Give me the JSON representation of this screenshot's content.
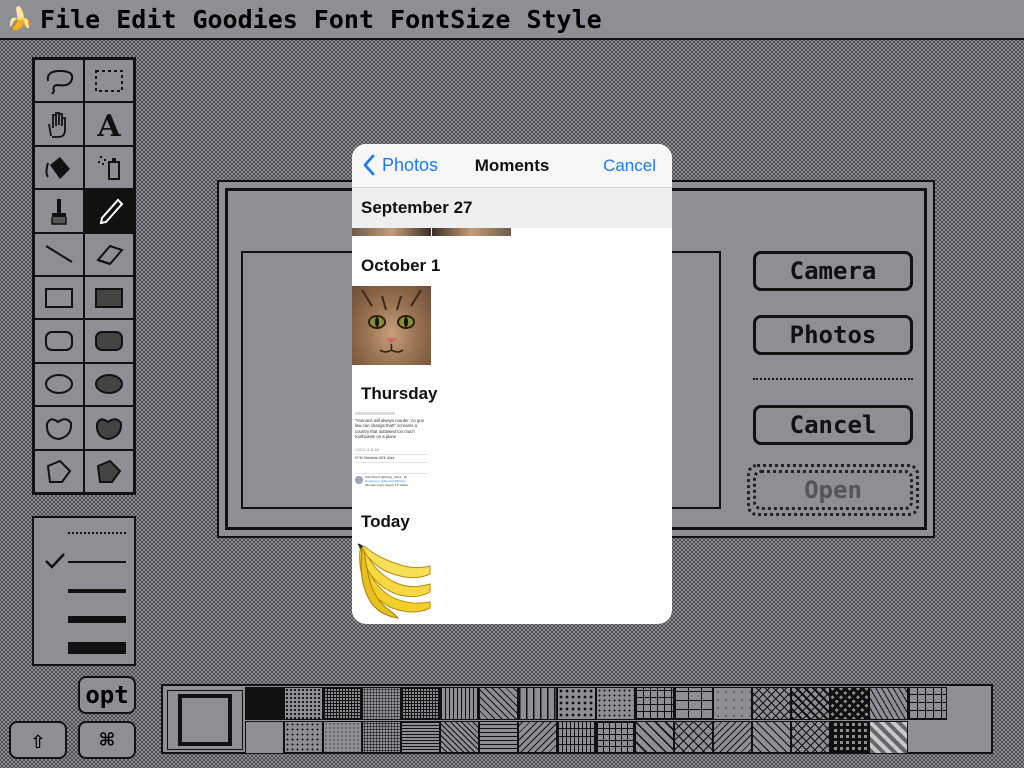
{
  "menubar": {
    "logo_icon": "banana-icon",
    "items": [
      "File",
      "Edit",
      "Goodies",
      "Font",
      "FontSize",
      "Style"
    ]
  },
  "tools": [
    {
      "name": "lasso-tool",
      "icon": "lasso-icon"
    },
    {
      "name": "marquee-tool",
      "icon": "dashed-rectangle-icon"
    },
    {
      "name": "hand-tool",
      "icon": "hand-icon"
    },
    {
      "name": "text-tool",
      "icon": "letter-a-icon"
    },
    {
      "name": "fill-tool",
      "icon": "paint-bucket-icon"
    },
    {
      "name": "spray-tool",
      "icon": "spray-can-icon"
    },
    {
      "name": "brush-tool",
      "icon": "brush-icon"
    },
    {
      "name": "pencil-tool",
      "icon": "pencil-icon",
      "selected": true
    },
    {
      "name": "line-tool",
      "icon": "diagonal-line-icon"
    },
    {
      "name": "eraser-tool",
      "icon": "eraser-icon"
    },
    {
      "name": "rectangle-tool",
      "icon": "rectangle-icon"
    },
    {
      "name": "filled-rectangle-tool",
      "icon": "filled-rectangle-icon"
    },
    {
      "name": "rounded-rect-tool",
      "icon": "rounded-rectangle-icon"
    },
    {
      "name": "filled-rounded-rect-tool",
      "icon": "filled-rounded-rectangle-icon"
    },
    {
      "name": "oval-tool",
      "icon": "oval-icon"
    },
    {
      "name": "filled-oval-tool",
      "icon": "filled-oval-icon"
    },
    {
      "name": "freeform-tool",
      "icon": "freeform-shape-icon"
    },
    {
      "name": "filled-freeform-tool",
      "icon": "filled-freeform-shape-icon"
    },
    {
      "name": "polygon-tool",
      "icon": "polygon-icon"
    },
    {
      "name": "filled-polygon-tool",
      "icon": "filled-polygon-icon"
    }
  ],
  "line_widths": {
    "selected_index": 1,
    "check_icon": "checkmark-icon"
  },
  "modifier_keys": {
    "opt_label": "opt",
    "shift_label": "⇧",
    "cmd_label": "⌘"
  },
  "dialog": {
    "camera_label": "Camera",
    "photos_label": "Photos",
    "cancel_label": "Cancel",
    "open_label": "Open"
  },
  "picker": {
    "back_label": "Photos",
    "title": "Moments",
    "cancel_label": "Cancel",
    "sections": [
      {
        "title": "September 27"
      },
      {
        "title": "October 1"
      },
      {
        "title": "Thursday"
      },
      {
        "title": "Today"
      }
    ],
    "tweet_thumb": {
      "text": "\"Humans will always murder, no gun law can change that!\" screams a country that outlawed too much toothpaste on a plane",
      "meta": "10/2/17, 8:36 AM",
      "stats": "57.9K Retweets 152K Likes",
      "reply_author": "Nick Peters @Pretty_Chick · 2d",
      "reply_to": "Replying to @NeonwithShimer",
      "reply_text": "this was crazy. Nearly 1.8 million"
    }
  },
  "colors": {
    "ios_blue": "#1a7cf5",
    "mac_gray": "#8e8e95",
    "ink": "#111111",
    "banana_yellow": "#f3cf2a"
  }
}
